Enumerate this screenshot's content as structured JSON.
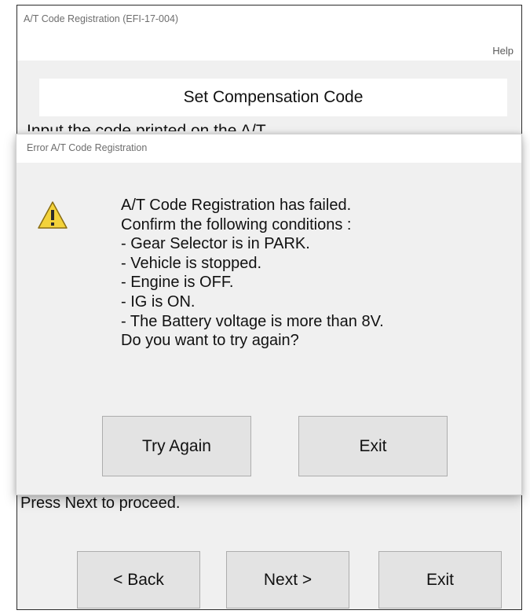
{
  "window": {
    "title": "A/T Code Registration (EFI-17-004)",
    "menu_help": "Help"
  },
  "main": {
    "header": "Set Compensation Code",
    "instruction_top": "Input the code printed on the A/T.",
    "instruction_bottom": "Press Next to proceed.",
    "buttons": {
      "back": "< Back",
      "next": "Next >",
      "exit": "Exit"
    }
  },
  "dialog": {
    "title": "Error A/T Code Registration",
    "icon": "warning-icon",
    "lines": [
      "A/T Code Registration has failed.",
      "Confirm the following conditions :",
      "- Gear Selector is in PARK.",
      "- Vehicle is stopped.",
      "- Engine is OFF.",
      "- IG is ON.",
      "- The Battery voltage is more than 8V.",
      "Do you want to try again?"
    ],
    "buttons": {
      "try_again": "Try Again",
      "exit": "Exit"
    }
  },
  "colors": {
    "window_bg": "#f0f0f0",
    "button_bg": "#e3e3e3",
    "button_border": "#adadad",
    "warning_fill": "#f3d23a"
  }
}
